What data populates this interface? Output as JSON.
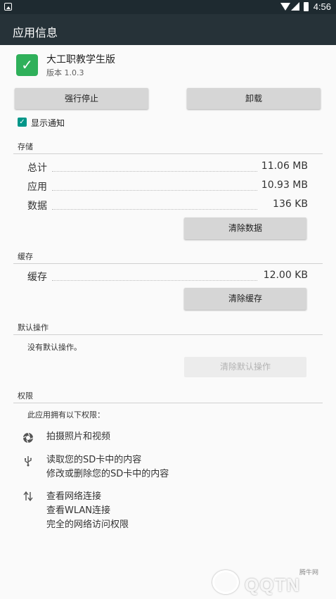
{
  "status_bar": {
    "time": "4:56",
    "icons": [
      "notification-icon",
      "wifi-icon",
      "signal-icon",
      "battery-icon"
    ]
  },
  "app_bar": {
    "title": "应用信息"
  },
  "app": {
    "name": "大工职教学生版",
    "version": "版本 1.0.3",
    "icon_color": "#2fb05a"
  },
  "actions": {
    "force_stop": "强行停止",
    "uninstall": "卸载"
  },
  "notifications": {
    "label": "显示通知",
    "checked": true,
    "accent": "#009688"
  },
  "storage": {
    "title": "存储",
    "rows": [
      {
        "label": "总计",
        "value": "11.06 MB"
      },
      {
        "label": "应用",
        "value": "10.93 MB"
      },
      {
        "label": "数据",
        "value": "136 KB"
      }
    ],
    "clear_button": "清除数据"
  },
  "cache": {
    "title": "缓存",
    "rows": [
      {
        "label": "缓存",
        "value": "12.00 KB"
      }
    ],
    "clear_button": "清除缓存"
  },
  "defaults": {
    "title": "默认操作",
    "text": "没有默认操作。",
    "clear_button": "清除默认操作"
  },
  "permissions": {
    "title": "权限",
    "intro": "此应用拥有以下权限：",
    "groups": [
      {
        "icon": "camera-icon",
        "items": [
          "拍摄照片和视频"
        ]
      },
      {
        "icon": "usb-storage-icon",
        "items": [
          "读取您的SD卡中的内容",
          "修改或删除您的SD卡中的内容"
        ]
      },
      {
        "icon": "network-arrows-icon",
        "items": [
          "查看网络连接",
          "查看WLAN连接",
          "完全的网络访问权限"
        ]
      }
    ]
  },
  "watermark": {
    "text": "QQTN",
    "small": "腾牛网"
  }
}
